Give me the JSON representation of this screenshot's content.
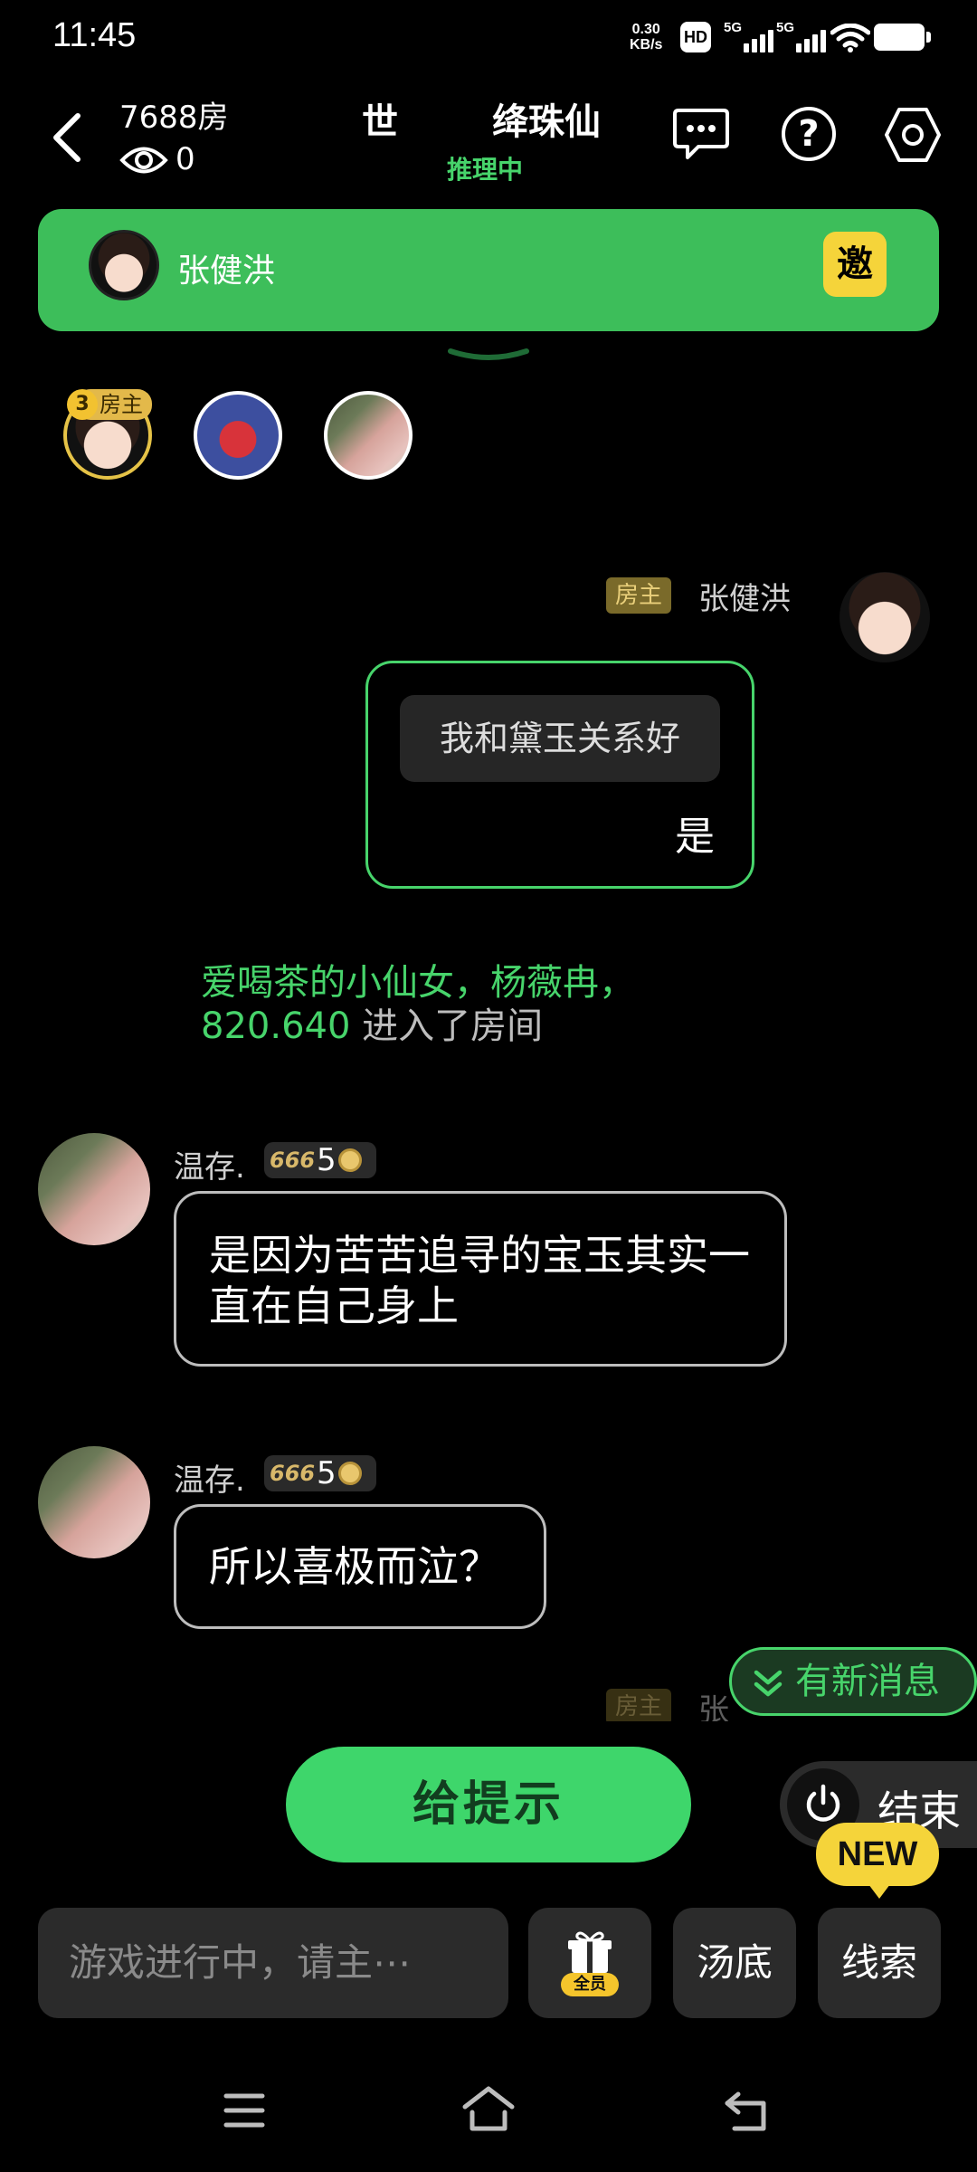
{
  "status_bar": {
    "time": "11:45",
    "net_speed_value": "0.30",
    "net_speed_unit": "KB/s",
    "hd_label": "HD",
    "signal1_label": "5G",
    "signal2_label": "5G"
  },
  "header": {
    "room_number": "7688房",
    "viewer_count": "0",
    "title_left": "世",
    "title_main": "绛珠仙",
    "game_status": "推理中"
  },
  "host_banner": {
    "host_name": "张健洪",
    "invite_label": "邀"
  },
  "members": [
    {
      "name": "host",
      "level": "3",
      "badge": "房主"
    },
    {
      "name": "member-2"
    },
    {
      "name": "member-3"
    }
  ],
  "messages": {
    "host_message": {
      "badge": "房主",
      "name": "张健洪",
      "quote": "我和黛玉关系好",
      "answer": "是"
    },
    "system_notice": {
      "highlight": "爱喝茶的小仙女，杨薇冉，820.640",
      "text": " 进入了房间"
    },
    "chat": [
      {
        "name": "温存.",
        "level": "5",
        "text": "是因为苦苦追寻的宝玉其实一直在自己身上"
      },
      {
        "name": "温存.",
        "level": "5",
        "text": "所以喜极而泣？"
      }
    ],
    "partial_host_badge": "房主",
    "partial_host_name": "张"
  },
  "new_messages_label": "有新消息",
  "hint_button": "给提示",
  "end_button": "结束",
  "new_badge": "NEW",
  "input": {
    "placeholder": "游戏进行中，请主⋯"
  },
  "gift_tag": "全员",
  "answer_button": "汤底",
  "clues_button": "线索",
  "colors": {
    "accent_green": "#3dbe5a",
    "invite_yellow": "#f5d43a",
    "background": "#000000"
  },
  "icons": {
    "back": "chevron-left-icon",
    "viewers": "eye-icon",
    "chat": "chat-bubble-icon",
    "help": "question-icon",
    "settings": "hexagon-settings-icon",
    "collapse": "chevron-down-icon",
    "new_messages": "double-chevron-down-icon",
    "end": "power-icon",
    "gift": "gift-icon",
    "nav_menu": "menu-icon",
    "nav_home": "home-icon",
    "nav_back": "back-icon"
  }
}
